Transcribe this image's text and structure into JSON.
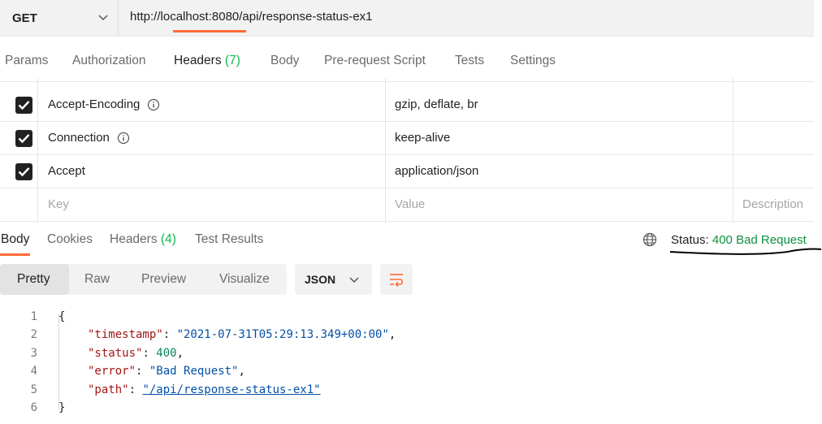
{
  "request": {
    "method": "GET",
    "url": "http://localhost:8080/api/response-status-ex1"
  },
  "request_tabs": {
    "params": "Params",
    "authorization": "Authorization",
    "headers": "Headers",
    "headers_count": "(7)",
    "body": "Body",
    "pre_request": "Pre-request Script",
    "tests": "Tests",
    "settings": "Settings"
  },
  "headers_table": {
    "rows": [
      {
        "key": "Accept-Encoding",
        "value": "gzip, deflate, br"
      },
      {
        "key": "Connection",
        "value": "keep-alive"
      },
      {
        "key": "Accept",
        "value": "application/json"
      }
    ],
    "placeholder": {
      "key": "Key",
      "value": "Value",
      "description": "Description"
    }
  },
  "response_tabs": {
    "body": "Body",
    "cookies": "Cookies",
    "headers": "Headers",
    "headers_count": "(4)",
    "test_results": "Test Results"
  },
  "status": {
    "label": "Status:",
    "value": "400 Bad Request"
  },
  "view_modes": [
    "Pretty",
    "Raw",
    "Preview",
    "Visualize"
  ],
  "format": "JSON",
  "response_body": {
    "line_numbers": [
      "1",
      "2",
      "3",
      "4",
      "5",
      "6"
    ],
    "open_brace": "{",
    "close_brace": "}",
    "fields": [
      {
        "key": "\"timestamp\"",
        "value": "\"2021-07-31T05:29:13.349+00:00\"",
        "comma": ","
      },
      {
        "key": "\"status\"",
        "value": "400",
        "comma": ","
      },
      {
        "key": "\"error\"",
        "value": "\"Bad Request\"",
        "comma": ","
      },
      {
        "key": "\"path\"",
        "value": "\"/api/response-status-ex1\"",
        "comma": ""
      }
    ]
  },
  "icons": {
    "method_dropdown": "chevron-down-icon",
    "info": "info-icon",
    "checkbox": "check-icon",
    "globe": "globe-icon",
    "format_dropdown": "chevron-down-icon",
    "wrap": "wrap-lines-icon"
  },
  "colors": {
    "accent": "#ff6c37",
    "count_green": "#0cbb52",
    "status_green": "#0c8f3f",
    "json_key": "#a31515",
    "json_string": "#0451a5",
    "json_number": "#098658"
  }
}
